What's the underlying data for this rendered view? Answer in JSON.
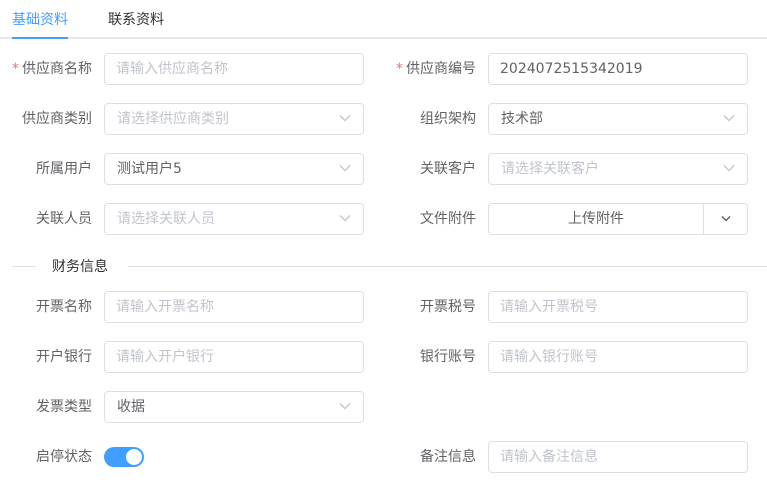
{
  "tabs": [
    {
      "label": "基础资料",
      "active": true
    },
    {
      "label": "联系资料",
      "active": false
    }
  ],
  "accent_color": "#409eff",
  "required_mark": "*",
  "form": {
    "supplier_name": {
      "label": "供应商名称",
      "required": true,
      "placeholder": "请输入供应商名称",
      "value": ""
    },
    "supplier_code": {
      "label": "供应商编号",
      "required": true,
      "value": "2024072515342019"
    },
    "supplier_category": {
      "label": "供应商类别",
      "placeholder": "请选择供应商类别"
    },
    "organization": {
      "label": "组织架构",
      "value": "技术部"
    },
    "owner_user": {
      "label": "所属用户",
      "value": "测试用户5"
    },
    "related_customer": {
      "label": "关联客户",
      "placeholder": "请选择关联客户"
    },
    "related_person": {
      "label": "关联人员",
      "placeholder": "请选择关联人员"
    },
    "attachment": {
      "label": "文件附件",
      "button": "上传附件"
    }
  },
  "finance_section": {
    "title": "财务信息",
    "invoice_name": {
      "label": "开票名称",
      "placeholder": "请输入开票名称",
      "value": ""
    },
    "invoice_tax_no": {
      "label": "开票税号",
      "placeholder": "请输入开票税号",
      "value": ""
    },
    "bank": {
      "label": "开户银行",
      "placeholder": "请输入开户银行",
      "value": ""
    },
    "bank_account": {
      "label": "银行账号",
      "placeholder": "请输入银行账号",
      "value": ""
    },
    "invoice_type": {
      "label": "发票类型",
      "value": "收据"
    },
    "status": {
      "label": "启停状态",
      "enabled": true
    },
    "remark": {
      "label": "备注信息",
      "placeholder": "请输入备注信息",
      "value": ""
    }
  }
}
